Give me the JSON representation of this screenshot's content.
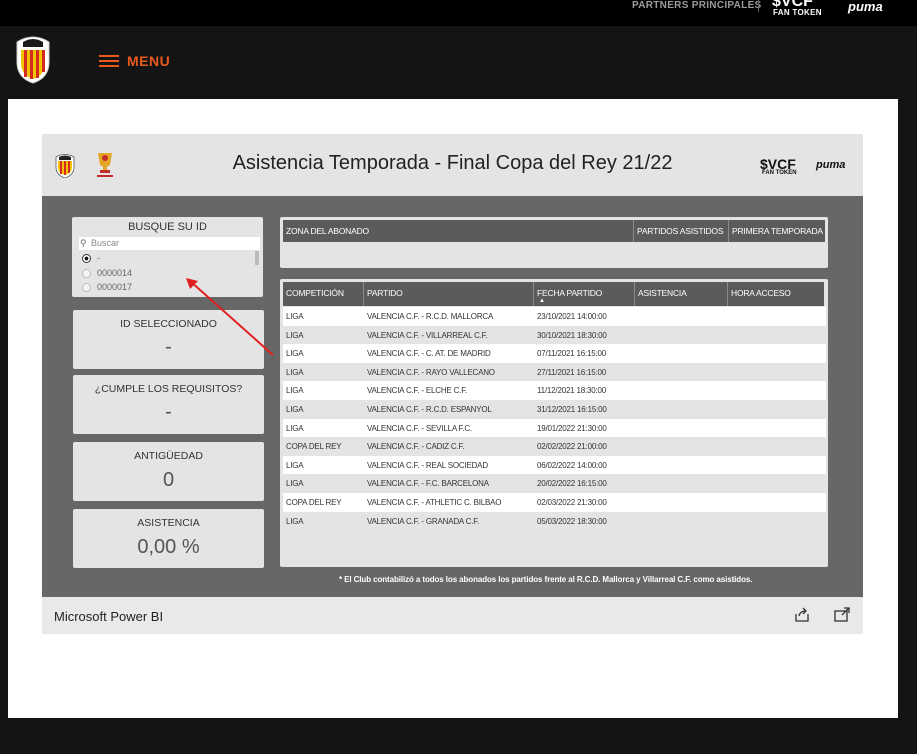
{
  "topbar": {
    "partners_label": "PARTNERS PRINCIPALES",
    "vcf_brand": "$VCF",
    "fan_token": "FAN TOKEN",
    "puma": "puma"
  },
  "nav": {
    "menu_label": "MENU"
  },
  "report": {
    "title": "Asistencia Temporada - Final Copa del Rey 21/22",
    "sponsor_vcf": "$VCF",
    "sponsor_fan_token": "FAN TOKEN",
    "sponsor_puma": "puma",
    "search_card": {
      "title": "BUSQUE SU ID",
      "placeholder": "Buscar",
      "options": [
        "-",
        "0000014",
        "0000017"
      ]
    },
    "cards": [
      {
        "title": "ID SELECCIONADO",
        "value": "-"
      },
      {
        "title": "¿CUMPLE LOS REQUISITOS?",
        "value": "-"
      },
      {
        "title": "ANTIGÜEDAD",
        "value": "0"
      },
      {
        "title": "ASISTENCIA",
        "value": "0,00 %"
      }
    ],
    "summary_table": {
      "columns": [
        "ZONA DEL ABONADO",
        "PARTIDOS ASISTIDOS",
        "PRIMERA TEMPORADA"
      ]
    },
    "matches_table": {
      "columns": [
        "COMPETICIÓN",
        "PARTIDO",
        "FECHA PARTIDO",
        "ASISTENCIA",
        "HORA ACCESO"
      ],
      "rows": [
        [
          "LIGA",
          "VALENCIA C.F. - R.C.D. MALLORCA",
          "23/10/2021 14:00:00"
        ],
        [
          "LIGA",
          "VALENCIA C.F. - VILLARREAL C.F.",
          "30/10/2021 18:30:00"
        ],
        [
          "LIGA",
          "VALENCIA C.F. - C. AT. DE MADRID",
          "07/11/2021 16:15:00"
        ],
        [
          "LIGA",
          "VALENCIA C.F. - RAYO VALLECANO",
          "27/11/2021 16:15:00"
        ],
        [
          "LIGA",
          "VALENCIA C.F. - ELCHE C.F.",
          "11/12/2021 18:30:00"
        ],
        [
          "LIGA",
          "VALENCIA C.F. - R.C.D. ESPANYOL",
          "31/12/2021 16:15:00"
        ],
        [
          "LIGA",
          "VALENCIA C.F. - SEVILLA F.C.",
          "19/01/2022 21:30:00"
        ],
        [
          "COPA DEL REY",
          "VALENCIA C.F. - CADIZ C.F.",
          "02/02/2022 21:00:00"
        ],
        [
          "LIGA",
          "VALENCIA C.F. - REAL SOCIEDAD",
          "06/02/2022 14:00:00"
        ],
        [
          "LIGA",
          "VALENCIA C.F. - F.C. BARCELONA",
          "20/02/2022 16:15:00"
        ],
        [
          "COPA DEL REY",
          "VALENCIA C.F. - ATHLETIC C. BILBAO",
          "02/03/2022 21:30:00"
        ],
        [
          "LIGA",
          "VALENCIA C.F. - GRANADA C.F.",
          "05/03/2022 18:30:00"
        ]
      ]
    },
    "footnote": "* El Club contabilizó a todos los abonados los partidos frente al R.C.D. Mallorca y Villarreal C.F. como asistidos."
  },
  "powerbi": {
    "label": "Microsoft Power BI",
    "share_icon": "share-icon",
    "fullscreen_icon": "open-external-icon"
  },
  "colors": {
    "accent": "#e9591c",
    "report_bg": "#676767",
    "card_bg": "#e4e4e4",
    "annotation_arrow": "#e02020"
  }
}
